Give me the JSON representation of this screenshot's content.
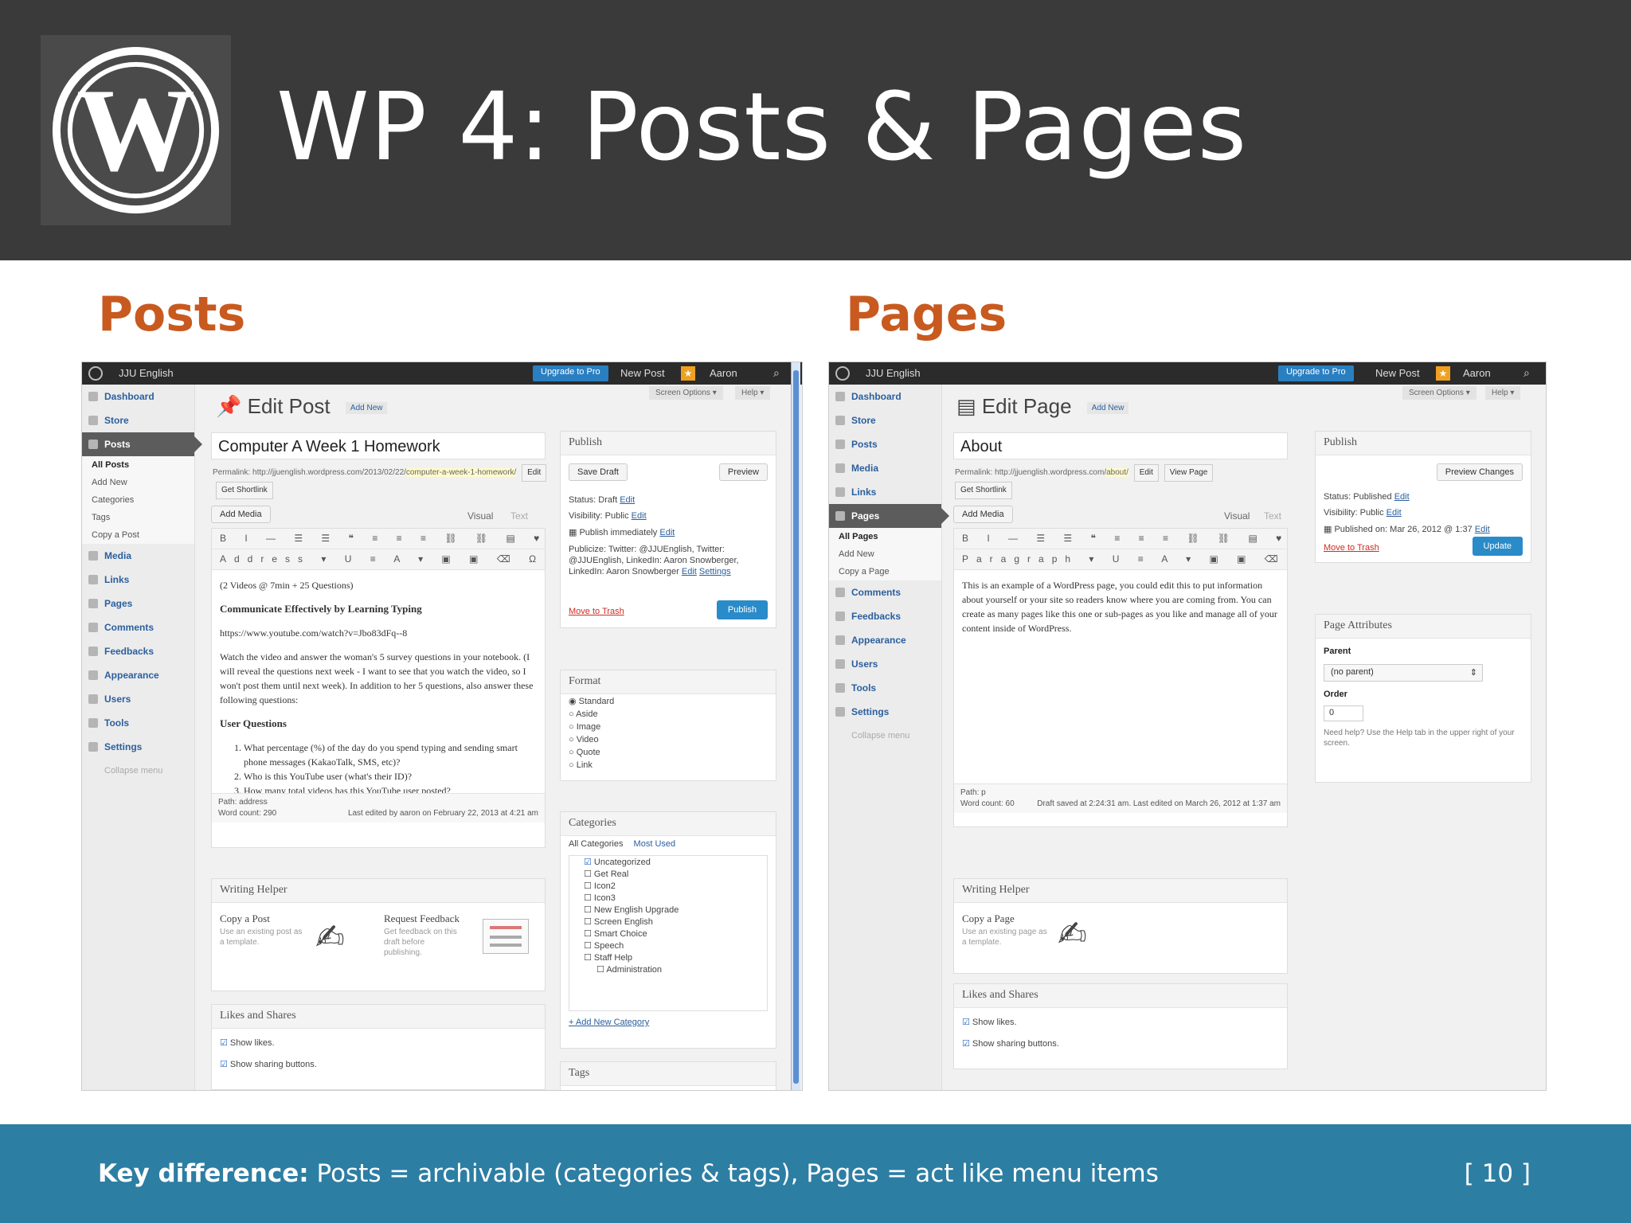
{
  "slide": {
    "title": "WP 4: Posts & Pages",
    "posts_label": "Posts",
    "pages_label": "Pages",
    "footer_bold": "Key difference:",
    "footer_text": " Posts = archivable (categories & tags), Pages = act like menu items",
    "page_number": "[ 10 ]"
  },
  "posts_shot": {
    "adminbar": {
      "site": "JJU English",
      "upgrade": "Upgrade to Pro",
      "new_item": "New Post",
      "user": "Aaron"
    },
    "sidebar": {
      "items": [
        "Dashboard",
        "Store",
        "Posts",
        "Media",
        "Links",
        "Pages",
        "Comments",
        "Feedbacks",
        "Appearance",
        "Users",
        "Tools",
        "Settings"
      ],
      "sub": [
        "All Posts",
        "Add New",
        "Categories",
        "Tags",
        "Copy a Post"
      ],
      "collapse": "Collapse menu"
    },
    "header": {
      "title": "Edit Post",
      "add_new": "Add New",
      "screen_options": "Screen Options ▾",
      "help": "Help ▾"
    },
    "post_title": "Computer A Week 1 Homework",
    "permalink": {
      "label": "Permalink:",
      "base": "http://jjuenglish.wordpress.com/2013/02/22/",
      "slug": "computer-a-week-1-homework/",
      "edit": "Edit",
      "shortlink": "Get Shortlink"
    },
    "media": {
      "add_media": "Add Media",
      "visual": "Visual",
      "text": "Text"
    },
    "toolbar": {
      "row1": "B I — ☰ ☰ ❝ ≡ ≡ ≡ ⛓ ⛓ ▤ ♥ ⛶ ▦",
      "row2": "Address ▾ U ≡ A ▾ ▣ ▣ ⌫ Ω ⇤ ⇥ ↶ ↷ ?"
    },
    "content": {
      "p1": "(2 Videos @ 7min + 25 Questions)",
      "h1": "Communicate Effectively by Learning Typing",
      "p2": "https://www.youtube.com/watch?v=Jbo83dFq--8",
      "p3": "Watch the video and answer the woman's 5 survey questions in your notebook. (I will reveal the questions next week - I want to see that you watch the video, so I won't post them until next week). In addition to her 5 questions, also answer these following questions:",
      "h2": "User Questions",
      "li1": "What percentage (%) of the day do you spend typing and sending smart phone messages (KakaoTalk, SMS, etc)?",
      "li2": "Who is this YouTube user (what's their ID)?",
      "li3": "How many total videos has this YouTube user posted?"
    },
    "editor_foot": {
      "path": "Path: address",
      "word_count": "Word count: 290",
      "last_edited": "Last edited by aaron on February 22, 2013 at 4:21 am"
    },
    "publish": {
      "title": "Publish",
      "save_draft": "Save Draft",
      "preview": "Preview",
      "status": "Status: Draft",
      "visibility": "Visibility: Public",
      "publish_when": "Publish immediately",
      "publicize": "Publicize: Twitter: @JJUEnglish, Twitter: @JJUEnglish, LinkedIn: Aaron Snowberger, LinkedIn: Aaron Snowberger",
      "edit": "Edit",
      "settings": "Settings",
      "trash": "Move to Trash",
      "publish_btn": "Publish"
    },
    "format": {
      "title": "Format",
      "options": [
        "Standard",
        "Aside",
        "Image",
        "Video",
        "Quote",
        "Link"
      ]
    },
    "categories": {
      "title": "Categories",
      "tab_all": "All Categories",
      "tab_used": "Most Used",
      "items": [
        "Uncategorized",
        "Get Real",
        "Icon2",
        "Icon3",
        "New English Upgrade",
        "Screen English",
        "Smart Choice",
        "Speech",
        "Staff Help"
      ],
      "sub_item": "Administration",
      "add_new": "+ Add New Category"
    },
    "tags_title": "Tags",
    "writing_helper": {
      "title": "Writing Helper",
      "copy_title": "Copy a Post",
      "copy_desc": "Use an existing post as a template.",
      "feedback_title": "Request Feedback",
      "feedback_desc": "Get feedback on this draft before publishing."
    },
    "likes": {
      "title": "Likes and Shares",
      "show_likes": "Show likes.",
      "show_sharing": "Show sharing buttons."
    }
  },
  "pages_shot": {
    "adminbar": {
      "site": "JJU English",
      "upgrade": "Upgrade to Pro",
      "new_item": "New Post",
      "user": "Aaron"
    },
    "sidebar": {
      "items": [
        "Dashboard",
        "Store",
        "Posts",
        "Media",
        "Links",
        "Pages",
        "Comments",
        "Feedbacks",
        "Appearance",
        "Users",
        "Tools",
        "Settings"
      ],
      "sub": [
        "All Pages",
        "Add New",
        "Copy a Page"
      ],
      "collapse": "Collapse menu"
    },
    "header": {
      "title": "Edit Page",
      "add_new": "Add New",
      "screen_options": "Screen Options ▾",
      "help": "Help ▾"
    },
    "page_title": "About",
    "permalink": {
      "label": "Permalink:",
      "base": "http://jjuenglish.wordpress.com/",
      "slug": "about/",
      "edit": "Edit",
      "view": "View Page",
      "shortlink": "Get Shortlink"
    },
    "media": {
      "add_media": "Add Media",
      "visual": "Visual",
      "text": "Text"
    },
    "toolbar": {
      "row1": "B I — ☰ ☰ ❝ ≡ ≡ ≡ ⛓ ⛓ ▤ ♥ ⛶ ▦",
      "row2": "Paragraph ▾ U ≡ A ▾ ▣ ▣ ⌫ Ω ⇤ ⇥ ↶ ↷ ?"
    },
    "content": "This is an example of a WordPress page, you could edit this to put information about yourself or your site so readers know where you are coming from. You can create as many pages like this one or sub-pages as you like and manage all of your content inside of WordPress.",
    "editor_foot": {
      "path": "Path: p",
      "word_count": "Word count: 60",
      "saved": "Draft saved at 2:24:31 am. Last edited on March 26, 2012 at 1:37 am"
    },
    "publish": {
      "title": "Publish",
      "preview": "Preview Changes",
      "status": "Status: Published",
      "visibility": "Visibility: Public",
      "published_on": "Published on: Mar 26, 2012 @ 1:37",
      "edit": "Edit",
      "trash": "Move to Trash",
      "update": "Update"
    },
    "attributes": {
      "title": "Page Attributes",
      "parent_label": "Parent",
      "parent_value": "(no parent)",
      "order_label": "Order",
      "order_value": "0",
      "help": "Need help? Use the Help tab in the upper right of your screen."
    },
    "writing_helper": {
      "title": "Writing Helper",
      "copy_title": "Copy a Page",
      "copy_desc": "Use an existing page as a template."
    },
    "likes": {
      "title": "Likes and Shares",
      "show_likes": "Show likes.",
      "show_sharing": "Show sharing buttons."
    }
  },
  "colors": {
    "header_bg": "#3a3a3a",
    "accent_orange": "#c85a1f",
    "footer_bg": "#2d7ea3",
    "wp_blue": "#2a8bc9"
  },
  "icons": {
    "logo": "wordpress-logo-icon",
    "pin": "pushpin-icon",
    "pen": "pen-icon"
  }
}
